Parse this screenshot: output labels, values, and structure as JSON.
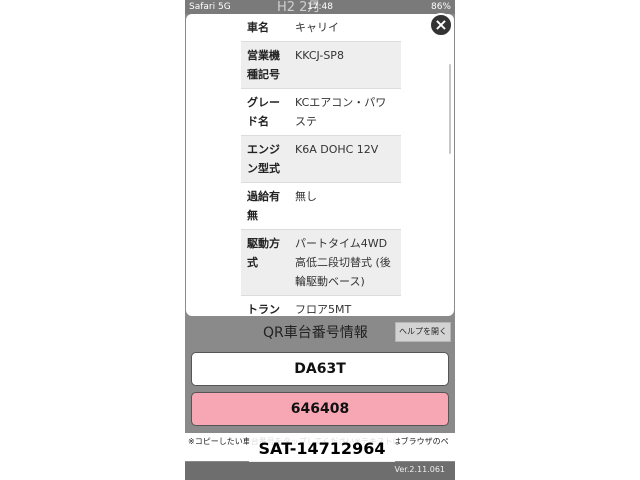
{
  "status_bar": {
    "carrier": "Safari 5G",
    "time": "17:48",
    "battery": "86%",
    "background_text": "H2  2月"
  },
  "modal": {
    "close_label": "×",
    "spec_rows": [
      {
        "label": "車名",
        "value": "キャリイ"
      },
      {
        "label": "営業機種記号",
        "value": "KKCJ-SP8"
      },
      {
        "label": "グレード名",
        "value": "KCエアコン・パワステ"
      },
      {
        "label": "エンジン型式",
        "value": "K6A DOHC 12V"
      },
      {
        "label": "過給有無",
        "value": "無し"
      },
      {
        "label": "駆動方式",
        "value": "パートタイム4WD 高低二段切替式 (後輪駆動ベース)"
      },
      {
        "label": "トラン",
        "value": "フロア5MT"
      }
    ]
  },
  "qr": {
    "title": "QR車台番号情報",
    "help_label": "ヘルプを開く",
    "vin_model": "DA63T",
    "serial": "646408",
    "note": "※コピーしたい車台番号をタップしてください※テキストはブラウザのペ",
    "overlay_text": "SAT-14712964"
  },
  "footer": {
    "version": "Ver.2.11.061"
  },
  "colors": {
    "serial_bg": "#f6a7b3",
    "backdrop": "#8a8a8a"
  }
}
